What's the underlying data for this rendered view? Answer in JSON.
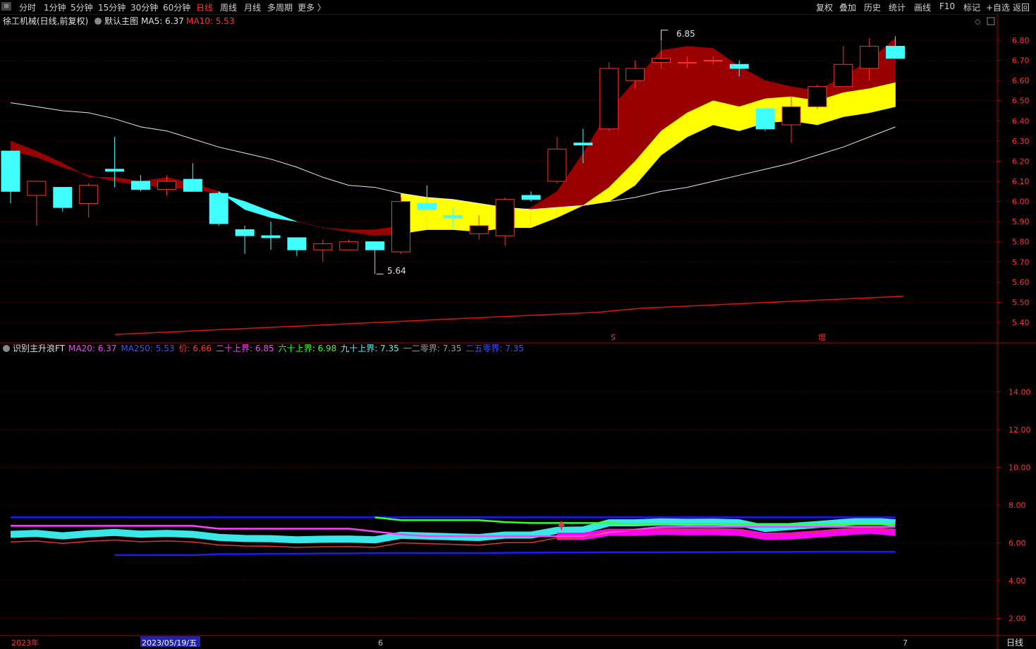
{
  "toolbar": {
    "left": [
      "分时",
      "1分钟",
      "5分钟",
      "15分钟",
      "30分钟",
      "60分钟",
      "日线",
      "周线",
      "月线",
      "多周期",
      "更多 〉"
    ],
    "active": "日线",
    "right": [
      "复权",
      "叠加",
      "历史",
      "统计",
      "画线",
      "F10",
      "标记",
      "+自选",
      "返回"
    ]
  },
  "main_header": {
    "stock": "徐工机械(日线,前复权)",
    "template": "默认主图",
    "ma5": "MA5: 6.37",
    "ma10": "MA10: 5.53"
  },
  "sub_header": {
    "name": "识别主升浪FT",
    "items": [
      {
        "text": "MA20: 6.37",
        "color": "#ff40ff"
      },
      {
        "text": "MA250: 5.53",
        "color": "#3355ff"
      },
      {
        "text": "价: 6.66",
        "color": "#ff3030"
      },
      {
        "text": "二十上界: 6.85",
        "color": "#ff40ff"
      },
      {
        "text": "六十上界: 6.98",
        "color": "#33ff33"
      },
      {
        "text": "九十上界: 7.35",
        "color": "#40ffff"
      },
      {
        "text": "一二零界: 7.35",
        "color": "#9a9a9a"
      },
      {
        "text": "二五零界: 7.35",
        "color": "#3355ff"
      }
    ]
  },
  "annotations": {
    "high_label": "6.85",
    "low_label": "5.64",
    "s_marker": "S",
    "zeng_marker": "增"
  },
  "xaxis": {
    "year": "2023年",
    "cursor_date": "2023/05/19/五",
    "month_6": "6",
    "month_7": "7",
    "period": "日线"
  },
  "colors": {
    "bull": "#ff3030",
    "bear": "#40ffff",
    "ribbon_red": "#990000",
    "ribbon_yellow": "#ffff00",
    "ribbon_cyan": "#40ffff",
    "ma250_line": "#dd1111",
    "axis": "#aa0000"
  },
  "chart_data": [
    {
      "type": "candlestick",
      "yticks": [
        "6.80",
        "6.70",
        "6.60",
        "6.50",
        "6.40",
        "6.30",
        "6.20",
        "6.10",
        "6.00",
        "5.90",
        "5.80",
        "5.70",
        "5.60",
        "5.50",
        "5.40"
      ],
      "ylim": [
        5.35,
        6.88
      ],
      "candles": [
        {
          "o": 6.25,
          "c": 6.05,
          "h": 6.25,
          "l": 5.99
        },
        {
          "o": 6.03,
          "c": 6.1,
          "h": 6.1,
          "l": 5.88
        },
        {
          "o": 6.07,
          "c": 5.97,
          "h": 6.07,
          "l": 5.95
        },
        {
          "o": 5.99,
          "c": 6.08,
          "h": 6.09,
          "l": 5.92
        },
        {
          "o": 6.16,
          "c": 6.15,
          "h": 6.32,
          "l": 6.07
        },
        {
          "o": 6.1,
          "c": 6.06,
          "h": 6.13,
          "l": 6.05
        },
        {
          "o": 6.06,
          "c": 6.1,
          "h": 6.13,
          "l": 6.03
        },
        {
          "o": 6.11,
          "c": 6.05,
          "h": 6.19,
          "l": 6.05
        },
        {
          "o": 6.04,
          "c": 5.89,
          "h": 6.05,
          "l": 5.88
        },
        {
          "o": 5.86,
          "c": 5.83,
          "h": 5.88,
          "l": 5.74
        },
        {
          "o": 5.83,
          "c": 5.82,
          "h": 5.9,
          "l": 5.76
        },
        {
          "o": 5.82,
          "c": 5.76,
          "h": 5.82,
          "l": 5.73
        },
        {
          "o": 5.76,
          "c": 5.79,
          "h": 5.81,
          "l": 5.7
        },
        {
          "o": 5.76,
          "c": 5.8,
          "h": 5.81,
          "l": 5.76
        },
        {
          "o": 5.8,
          "c": 5.76,
          "h": 5.8,
          "l": 5.64
        },
        {
          "o": 5.75,
          "c": 6.0,
          "h": 6.02,
          "l": 5.74
        },
        {
          "o": 5.99,
          "c": 5.96,
          "h": 6.08,
          "l": 5.96
        },
        {
          "o": 5.93,
          "c": 5.92,
          "h": 5.97,
          "l": 5.87
        },
        {
          "o": 5.84,
          "c": 5.88,
          "h": 5.93,
          "l": 5.81
        },
        {
          "o": 5.83,
          "c": 6.01,
          "h": 6.02,
          "l": 5.78
        },
        {
          "o": 6.03,
          "c": 6.01,
          "h": 6.05,
          "l": 6.0
        },
        {
          "o": 6.1,
          "c": 6.26,
          "h": 6.32,
          "l": 6.09
        },
        {
          "o": 6.29,
          "c": 6.28,
          "h": 6.36,
          "l": 6.19
        },
        {
          "o": 6.36,
          "c": 6.66,
          "h": 6.69,
          "l": 6.35
        },
        {
          "o": 6.6,
          "c": 6.66,
          "h": 6.7,
          "l": 6.56
        },
        {
          "o": 6.69,
          "c": 6.71,
          "h": 6.85,
          "l": 6.66
        },
        {
          "o": 6.69,
          "c": 6.69,
          "h": 6.72,
          "l": 6.66
        },
        {
          "o": 6.7,
          "c": 6.7,
          "h": 6.72,
          "l": 6.68
        },
        {
          "o": 6.68,
          "c": 6.66,
          "h": 6.7,
          "l": 6.62
        },
        {
          "o": 6.46,
          "c": 6.36,
          "h": 6.47,
          "l": 6.35
        },
        {
          "o": 6.38,
          "c": 6.47,
          "h": 6.52,
          "l": 6.29
        },
        {
          "o": 6.47,
          "c": 6.57,
          "h": 6.58,
          "l": 6.46
        },
        {
          "o": 6.57,
          "c": 6.68,
          "h": 6.77,
          "l": 6.57
        },
        {
          "o": 6.66,
          "c": 6.77,
          "h": 6.81,
          "l": 6.6
        },
        {
          "o": 6.77,
          "c": 6.71,
          "h": 6.82,
          "l": 6.71
        }
      ],
      "white_ma": [
        6.49,
        6.47,
        6.45,
        6.44,
        6.41,
        6.37,
        6.35,
        6.31,
        6.27,
        6.24,
        6.21,
        6.17,
        6.12,
        6.08,
        6.07,
        6.04,
        6.02,
        6.01,
        5.99,
        5.97,
        5.96,
        5.97,
        5.98,
        6.0,
        6.02,
        6.05,
        6.07,
        6.1,
        6.13,
        6.16,
        6.19,
        6.23,
        6.27,
        6.32,
        6.37
      ],
      "ribbon_fast": [
        6.3,
        6.25,
        6.19,
        6.12,
        6.12,
        6.1,
        6.12,
        6.09,
        6.05,
        5.96,
        5.92,
        5.9,
        5.87,
        5.86,
        5.86,
        5.88,
        5.92,
        5.9,
        5.9,
        5.94,
        5.97,
        6.05,
        6.24,
        6.45,
        6.6,
        6.75,
        6.77,
        6.76,
        6.67,
        6.6,
        6.57,
        6.55,
        6.62,
        6.7,
        6.81
      ],
      "ribbon_slow": [
        6.25,
        6.22,
        6.17,
        6.13,
        6.1,
        6.08,
        6.07,
        6.06,
        6.04,
        6.0,
        5.95,
        5.9,
        5.87,
        5.85,
        5.83,
        5.84,
        5.86,
        5.86,
        5.85,
        5.87,
        5.87,
        5.92,
        5.98,
        6.07,
        6.2,
        6.35,
        6.44,
        6.5,
        6.47,
        6.51,
        6.52,
        6.5,
        6.54,
        6.56,
        6.59
      ],
      "ma250": [
        5.34,
        5.35,
        5.36,
        5.37,
        5.38,
        5.39,
        5.4,
        5.41,
        5.42,
        5.43,
        5.44,
        5.45,
        5.47,
        5.48,
        5.49,
        5.5,
        5.51,
        5.52,
        5.53
      ]
    },
    {
      "type": "line",
      "name": "识别主升浪FT",
      "yticks": [
        "14.00",
        "12.00",
        "10.00",
        "8.00",
        "6.00",
        "4.00",
        "2.00"
      ],
      "ylim": [
        0,
        15
      ],
      "series": [
        {
          "name": "二五零界",
          "color": "#1a1aff",
          "values": [
            7.35,
            7.35,
            7.35,
            7.35,
            7.35,
            7.35,
            7.35,
            7.35,
            7.35,
            7.35,
            7.35,
            7.35,
            7.35,
            7.35,
            7.35,
            7.35,
            7.35,
            7.35,
            7.35,
            7.35,
            7.35,
            7.35,
            7.35,
            7.35,
            7.35,
            7.35,
            7.35,
            7.35,
            7.35,
            7.35,
            7.35,
            7.35,
            7.35,
            7.35,
            7.35
          ]
        },
        {
          "name": "六十上界",
          "color": "#33ff33",
          "values": [
            null,
            null,
            null,
            null,
            null,
            null,
            null,
            null,
            null,
            null,
            null,
            null,
            null,
            null,
            7.35,
            7.2,
            7.2,
            7.2,
            7.2,
            7.1,
            7.05,
            7.05,
            7.05,
            7.05,
            7.0,
            7.0,
            7.0,
            7.0,
            7.0,
            7.0,
            7.0,
            7.0,
            6.98,
            6.98,
            6.98
          ]
        },
        {
          "name": "二十上界",
          "color": "#ff40ff",
          "values": [
            6.9,
            6.9,
            6.9,
            6.9,
            6.9,
            6.9,
            6.9,
            6.9,
            6.75,
            6.75,
            6.75,
            6.75,
            6.75,
            6.75,
            6.6,
            6.45,
            6.35,
            6.35,
            6.35,
            6.35,
            6.35,
            6.35,
            6.35,
            6.55,
            6.7,
            6.85,
            6.85,
            6.85,
            6.85,
            6.85,
            6.85,
            6.85,
            6.85,
            6.85,
            6.85
          ]
        },
        {
          "name": "价",
          "color": "#dd3333",
          "values": [
            6.05,
            6.1,
            5.97,
            6.08,
            6.15,
            6.06,
            6.1,
            6.05,
            5.89,
            5.83,
            5.82,
            5.76,
            5.79,
            5.8,
            5.76,
            6.0,
            5.96,
            5.92,
            5.88,
            6.01,
            6.01,
            6.26,
            6.28,
            6.66,
            6.66,
            6.71,
            6.69,
            6.7,
            6.66,
            6.36,
            6.47,
            6.57,
            6.68,
            6.77,
            6.66
          ]
        },
        {
          "name": "MA250",
          "color": "#1a1aff",
          "values": [
            null,
            null,
            null,
            null,
            5.35,
            5.35,
            5.35,
            5.35,
            5.4,
            5.4,
            5.42,
            5.42,
            5.44,
            5.44,
            5.46,
            5.46,
            5.46,
            5.46,
            5.46,
            5.47,
            5.48,
            5.49,
            5.49,
            5.5,
            5.5,
            5.5,
            5.51,
            5.51,
            5.52,
            5.52,
            5.52,
            5.53,
            5.53,
            5.53,
            5.53
          ]
        }
      ]
    }
  ]
}
